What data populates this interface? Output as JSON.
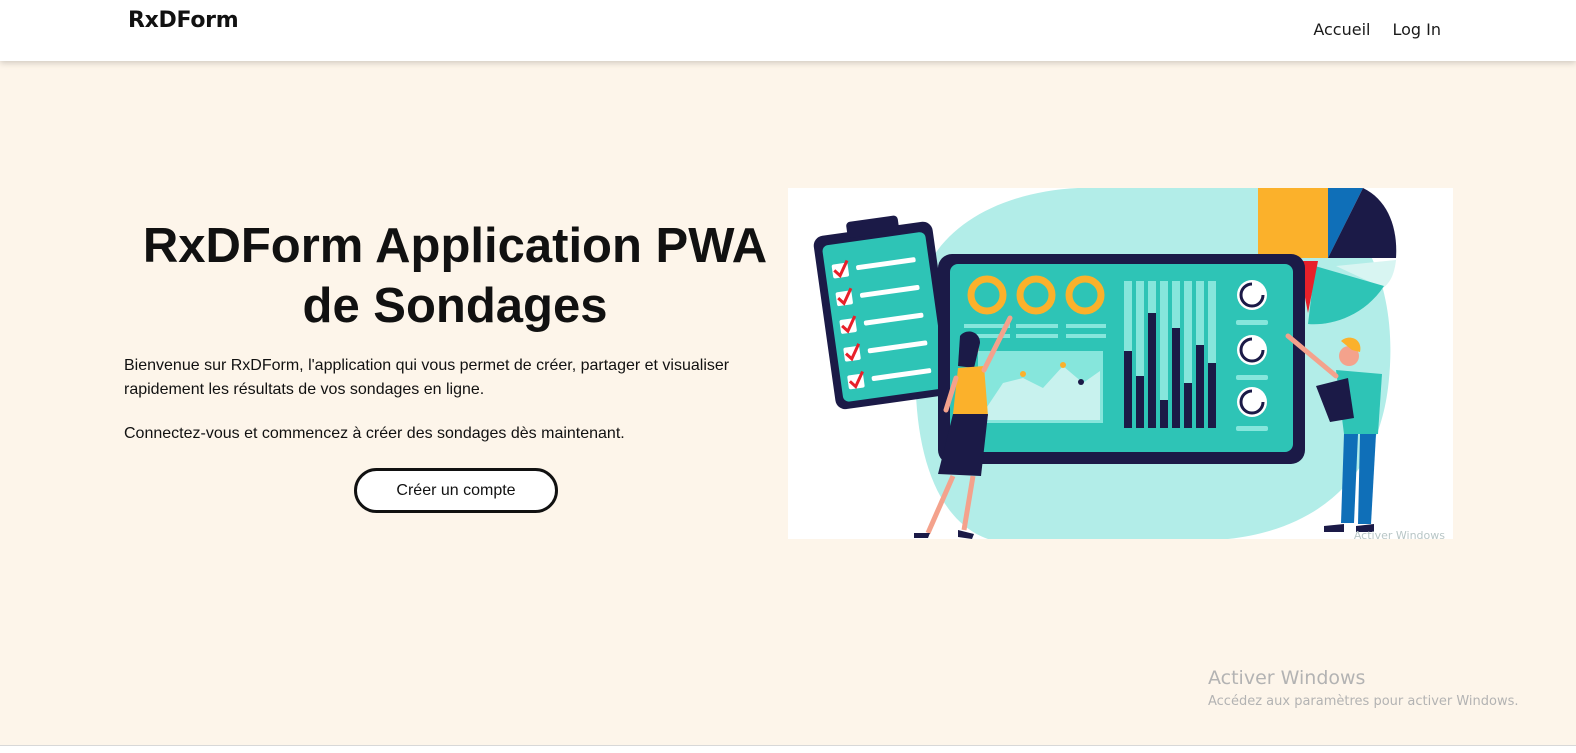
{
  "navbar": {
    "brand": "RxDForm",
    "links": [
      "Accueil",
      "Log In"
    ]
  },
  "hero": {
    "title_line1": "RxDForm Application PWA",
    "title_line2": "de Sondages",
    "paragraph1": "Bienvenue sur RxDForm, l'application qui vous permet de créer, partager et visualiser rapidement les résultats de vos sondages en ligne.",
    "paragraph2": "Connectez-vous et commencez à créer des sondages dès maintenant.",
    "cta_label": "Créer un compte"
  },
  "illustration": {
    "watermark_text": "Activer Windows"
  },
  "windows_watermark": {
    "title": "Activer Windows",
    "subtitle": "Accédez aux paramètres pour activer Windows."
  },
  "colors": {
    "page_background": "#fdf5ea",
    "navbar_background": "#ffffff",
    "teal": "#2ec4b6",
    "light_teal": "#b2ede8",
    "navy": "#1b1a47",
    "yellow": "#fbb12b",
    "red": "#e8202a",
    "blue": "#0f6fb8"
  }
}
